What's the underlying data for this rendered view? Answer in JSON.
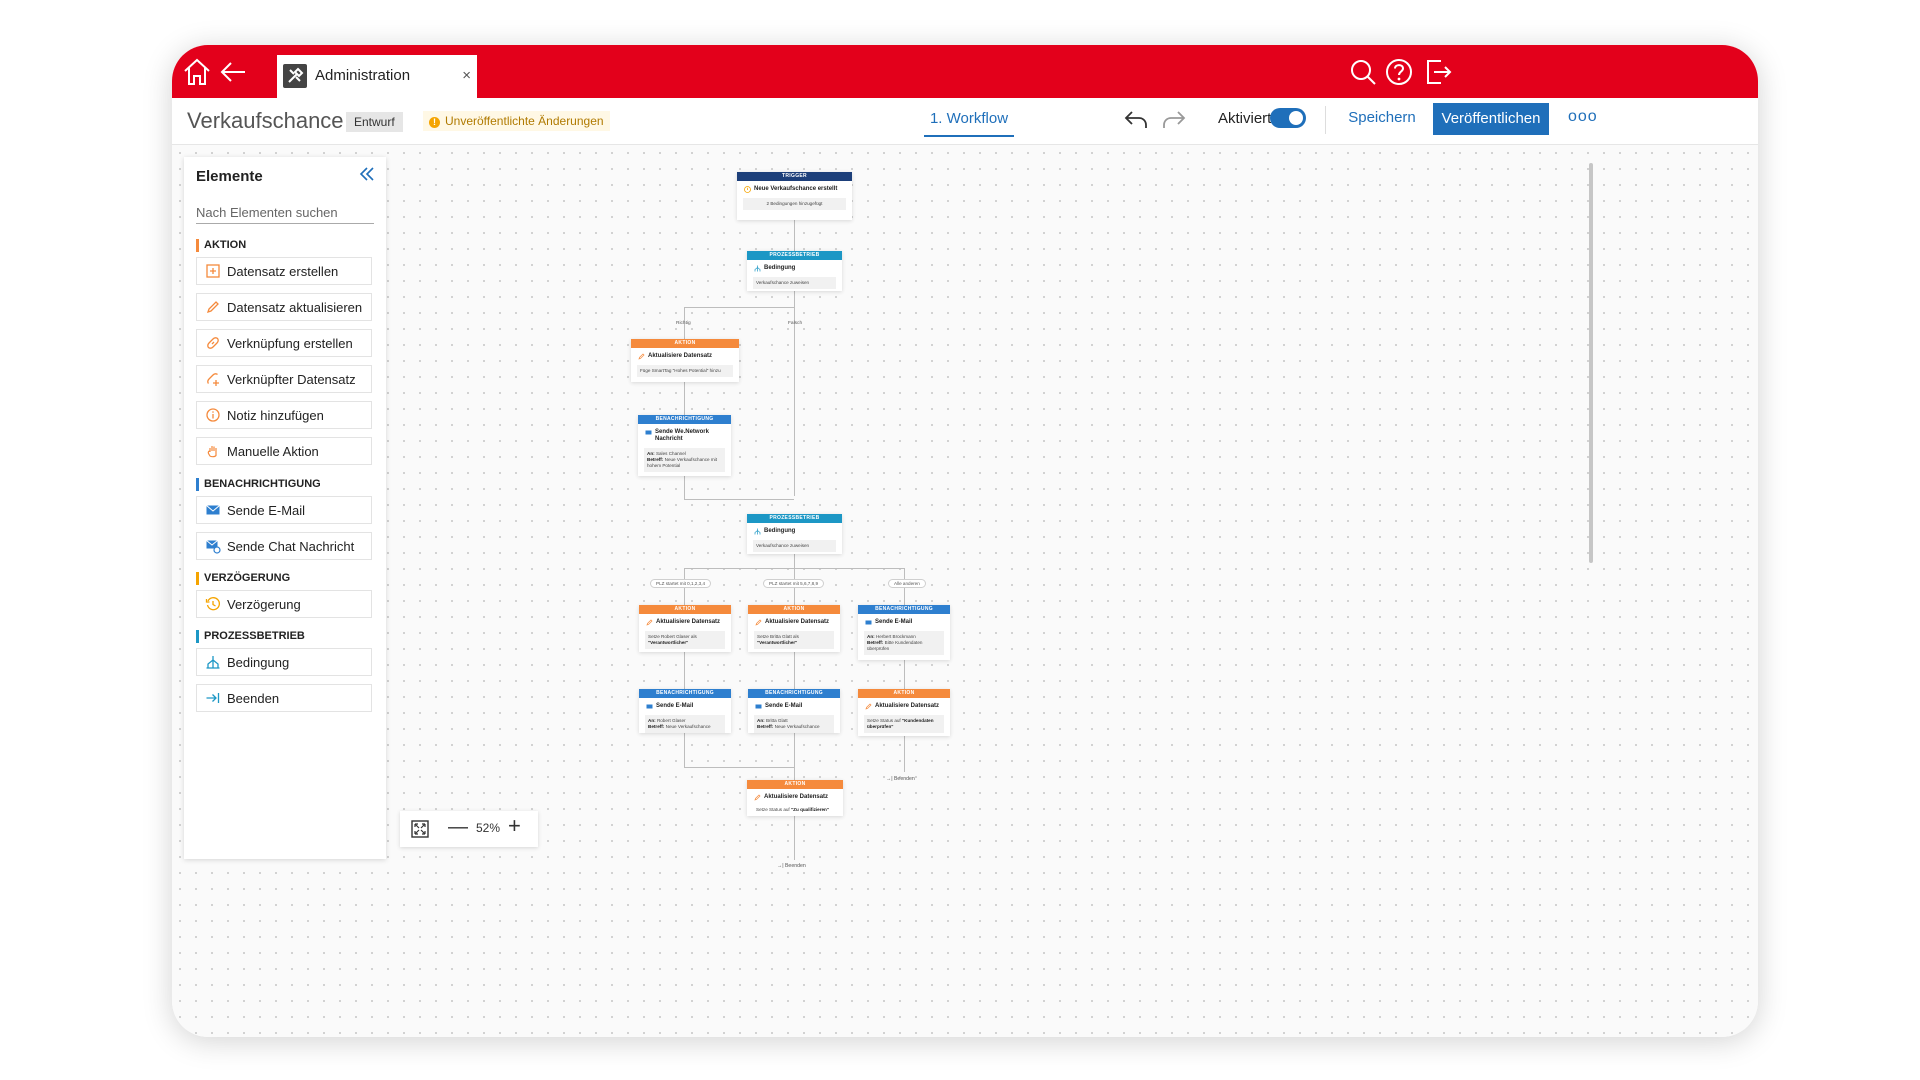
{
  "app": {
    "tab": {
      "label": "Administration",
      "close": "×"
    },
    "workflow_name": "Verkaufschance",
    "draft_badge": "Entwurf",
    "unpublished": "Unveröffentlichte Änderungen",
    "unpublished_icon": "!",
    "active_tab": "1. Workflow",
    "activated_label": "Aktiviert",
    "activated": true,
    "save_label": "Speichern",
    "publish_label": "Veröffentlichen",
    "more_label": "ooo"
  },
  "colors": {
    "brand": "#e3001b",
    "accent": "#1f6fba",
    "action": "#f58a3c",
    "notify": "#2e7fcf",
    "process": "#1c97c5",
    "delay": "#f5a400",
    "trigger": "#1d3f7a"
  },
  "panel": {
    "title": "Elemente",
    "search_placeholder": "Nach Elementen suchen",
    "sections": [
      {
        "title": "AKTION",
        "items": [
          {
            "label": "Datensatz erstellen",
            "icon": "add-record-icon"
          },
          {
            "label": "Datensatz aktualisieren",
            "icon": "pencil-icon"
          },
          {
            "label": "Verknüpfung erstellen",
            "icon": "link-icon"
          },
          {
            "label": "Verknüpfter Datensatz",
            "icon": "link-add-icon"
          },
          {
            "label": "Notiz hinzufügen",
            "icon": "info-icon"
          },
          {
            "label": "Manuelle Aktion",
            "icon": "hand-icon"
          }
        ]
      },
      {
        "title": "BENACHRICHTIGUNG",
        "items": [
          {
            "label": "Sende E-Mail",
            "icon": "mail-icon"
          },
          {
            "label": "Sende Chat Nachricht",
            "icon": "chat-mail-icon"
          }
        ]
      },
      {
        "title": "VERZÖGERUNG",
        "items": [
          {
            "label": "Verzögerung",
            "icon": "clock-icon"
          }
        ]
      },
      {
        "title": "PROZESSBETRIEB",
        "items": [
          {
            "label": "Bedingung",
            "icon": "branch-icon"
          },
          {
            "label": "Beenden",
            "icon": "end-arrow-icon"
          }
        ]
      }
    ]
  },
  "zoom": {
    "value": "52%",
    "minus": "—",
    "plus": "+"
  },
  "flow": {
    "trigger": {
      "head": "TRIGGER",
      "title": "Neue Verkaufschance erstellt",
      "desc": "2 Bedingungen hinzugefügt"
    },
    "cond1": {
      "head": "PROZESSBETRIEB",
      "title": "Bedingung",
      "desc": "Verkaufschance zuweisen"
    },
    "edge_true": "Richtig",
    "edge_false": "Falsch",
    "act1": {
      "head": "AKTION",
      "title": "Aktualisiere Datensatz",
      "desc": "Füge SmartTag \"Hohes Potential\" hinzu"
    },
    "notif1": {
      "head": "BENACHRICHTIGUNG",
      "title": "Sende We.Network Nachricht",
      "to_label": "An:",
      "to": "Sales Channel",
      "subj_label": "Betreff:",
      "subj": "Neue Verkaufschance mit hohem Potential"
    },
    "cond2": {
      "head": "PROZESSBETRIEB",
      "title": "Bedingung",
      "desc": "Verkaufschance zuweisen"
    },
    "branch_a": "PLZ startet mit 0,1,2,3,4",
    "branch_b": "PLZ startet mit 5,6,7,8,9",
    "branch_c": "Alle anderen",
    "act_a": {
      "head": "AKTION",
      "title": "Aktualisiere Datensatz",
      "desc_pre": "Setze Robert Glaser als",
      "desc_bold": "\"Verantwortlicher\""
    },
    "act_b": {
      "head": "AKTION",
      "title": "Aktualisiere Datensatz",
      "desc_pre": "Setze Britta Glatt als",
      "desc_bold": "\"Verantwortlicher\""
    },
    "mail_c": {
      "head": "BENACHRICHTIGUNG",
      "title": "Sende E-Mail",
      "to_label": "An:",
      "to": "Herbert Brockmann",
      "subj_label": "Betreff:",
      "subj": "Bitte Kundendaten überprüfen"
    },
    "mail_a": {
      "head": "BENACHRICHTIGUNG",
      "title": "Sende E-Mail",
      "to_label": "An:",
      "to": "Robert Glaser",
      "subj_label": "Betreff:",
      "subj": "Neue Verkaufschance"
    },
    "mail_b": {
      "head": "BENACHRICHTIGUNG",
      "title": "Sende E-Mail",
      "to_label": "An:",
      "to": "Britta Glatt",
      "subj_label": "Betreff:",
      "subj": "Neue Verkaufschance"
    },
    "act_c": {
      "head": "AKTION",
      "title": "Aktualisiere Datensatz",
      "desc_pre": "Setze Status auf",
      "desc_bold": "\"Kundendaten überprüfen\""
    },
    "end_c": "→| Beenden",
    "act_final": {
      "head": "AKTION",
      "title": "Aktualisiere Datensatz",
      "desc_pre": "Setze Status auf",
      "desc_bold": "\"Zu qualifizieren\""
    },
    "end_final": "→| Beenden"
  }
}
